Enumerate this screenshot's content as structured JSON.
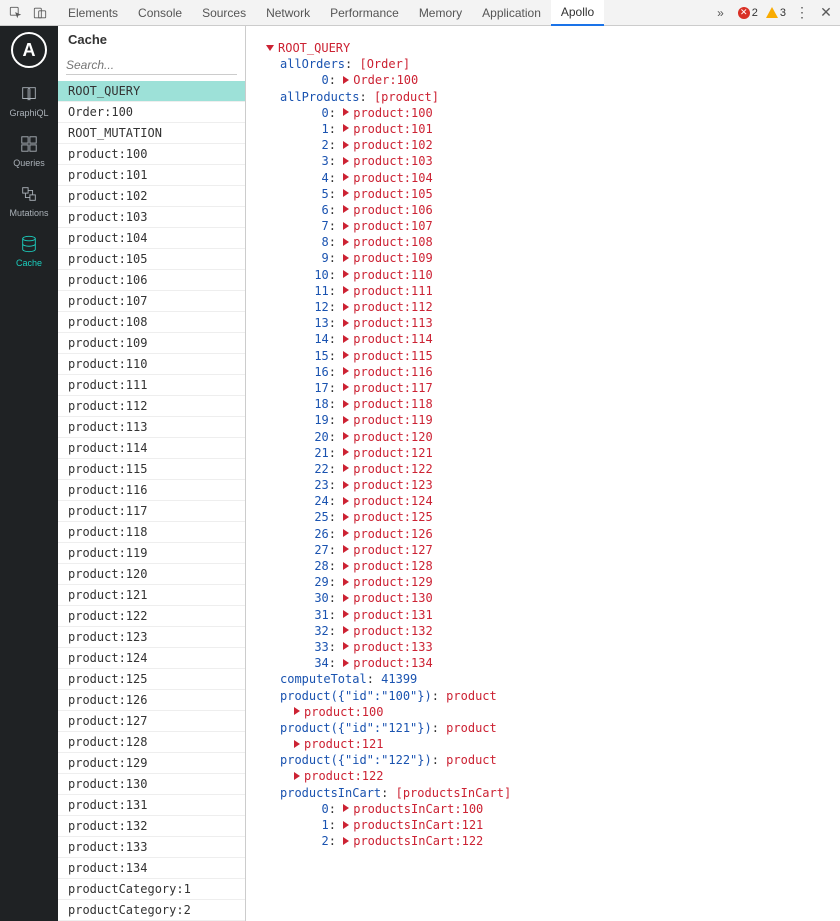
{
  "devtools": {
    "tabs": [
      "Elements",
      "Console",
      "Sources",
      "Network",
      "Performance",
      "Memory",
      "Application",
      "Apollo"
    ],
    "active_tab": "Apollo",
    "overflow": "»",
    "errors": 2,
    "warnings": 3,
    "more": "⋮",
    "close": "✕"
  },
  "vnav": {
    "logo": "A",
    "items": [
      {
        "key": "graphiql",
        "label": "GraphiQL",
        "icon": "book"
      },
      {
        "key": "queries",
        "label": "Queries",
        "icon": "grid"
      },
      {
        "key": "mutations",
        "label": "Mutations",
        "icon": "mutation"
      },
      {
        "key": "cache",
        "label": "Cache",
        "icon": "database"
      }
    ],
    "active": "cache"
  },
  "sidebar": {
    "title": "Cache",
    "search_placeholder": "Search...",
    "selected": "ROOT_QUERY",
    "items": [
      "ROOT_QUERY",
      "Order:100",
      "ROOT_MUTATION",
      "product:100",
      "product:101",
      "product:102",
      "product:103",
      "product:104",
      "product:105",
      "product:106",
      "product:107",
      "product:108",
      "product:109",
      "product:110",
      "product:111",
      "product:112",
      "product:113",
      "product:114",
      "product:115",
      "product:116",
      "product:117",
      "product:118",
      "product:119",
      "product:120",
      "product:121",
      "product:122",
      "product:123",
      "product:124",
      "product:125",
      "product:126",
      "product:127",
      "product:128",
      "product:129",
      "product:130",
      "product:131",
      "product:132",
      "product:133",
      "product:134",
      "productCategory:1",
      "productCategory:2"
    ]
  },
  "tree": {
    "root": "ROOT_QUERY",
    "fields": [
      {
        "key": "allOrders",
        "type_bracket": "[Order]",
        "items": [
          {
            "idx": 0,
            "ref": "Order:100"
          }
        ]
      },
      {
        "key": "allProducts",
        "type_bracket": "[product]",
        "items": [
          {
            "idx": 0,
            "ref": "product:100"
          },
          {
            "idx": 1,
            "ref": "product:101"
          },
          {
            "idx": 2,
            "ref": "product:102"
          },
          {
            "idx": 3,
            "ref": "product:103"
          },
          {
            "idx": 4,
            "ref": "product:104"
          },
          {
            "idx": 5,
            "ref": "product:105"
          },
          {
            "idx": 6,
            "ref": "product:106"
          },
          {
            "idx": 7,
            "ref": "product:107"
          },
          {
            "idx": 8,
            "ref": "product:108"
          },
          {
            "idx": 9,
            "ref": "product:109"
          },
          {
            "idx": 10,
            "ref": "product:110"
          },
          {
            "idx": 11,
            "ref": "product:111"
          },
          {
            "idx": 12,
            "ref": "product:112"
          },
          {
            "idx": 13,
            "ref": "product:113"
          },
          {
            "idx": 14,
            "ref": "product:114"
          },
          {
            "idx": 15,
            "ref": "product:115"
          },
          {
            "idx": 16,
            "ref": "product:116"
          },
          {
            "idx": 17,
            "ref": "product:117"
          },
          {
            "idx": 18,
            "ref": "product:118"
          },
          {
            "idx": 19,
            "ref": "product:119"
          },
          {
            "idx": 20,
            "ref": "product:120"
          },
          {
            "idx": 21,
            "ref": "product:121"
          },
          {
            "idx": 22,
            "ref": "product:122"
          },
          {
            "idx": 23,
            "ref": "product:123"
          },
          {
            "idx": 24,
            "ref": "product:124"
          },
          {
            "idx": 25,
            "ref": "product:125"
          },
          {
            "idx": 26,
            "ref": "product:126"
          },
          {
            "idx": 27,
            "ref": "product:127"
          },
          {
            "idx": 28,
            "ref": "product:128"
          },
          {
            "idx": 29,
            "ref": "product:129"
          },
          {
            "idx": 30,
            "ref": "product:130"
          },
          {
            "idx": 31,
            "ref": "product:131"
          },
          {
            "idx": 32,
            "ref": "product:132"
          },
          {
            "idx": 33,
            "ref": "product:133"
          },
          {
            "idx": 34,
            "ref": "product:134"
          }
        ]
      },
      {
        "key": "computeTotal",
        "scalar": 41399
      },
      {
        "key": "product({\"id\":\"100\"})",
        "type_plain": "product",
        "ref": "product:100"
      },
      {
        "key": "product({\"id\":\"121\"})",
        "type_plain": "product",
        "ref": "product:121"
      },
      {
        "key": "product({\"id\":\"122\"})",
        "type_plain": "product",
        "ref": "product:122"
      },
      {
        "key": "productsInCart",
        "type_bracket": "[productsInCart]",
        "items": [
          {
            "idx": 0,
            "ref": "productsInCart:100"
          },
          {
            "idx": 1,
            "ref": "productsInCart:121"
          },
          {
            "idx": 2,
            "ref": "productsInCart:122"
          }
        ]
      }
    ]
  }
}
